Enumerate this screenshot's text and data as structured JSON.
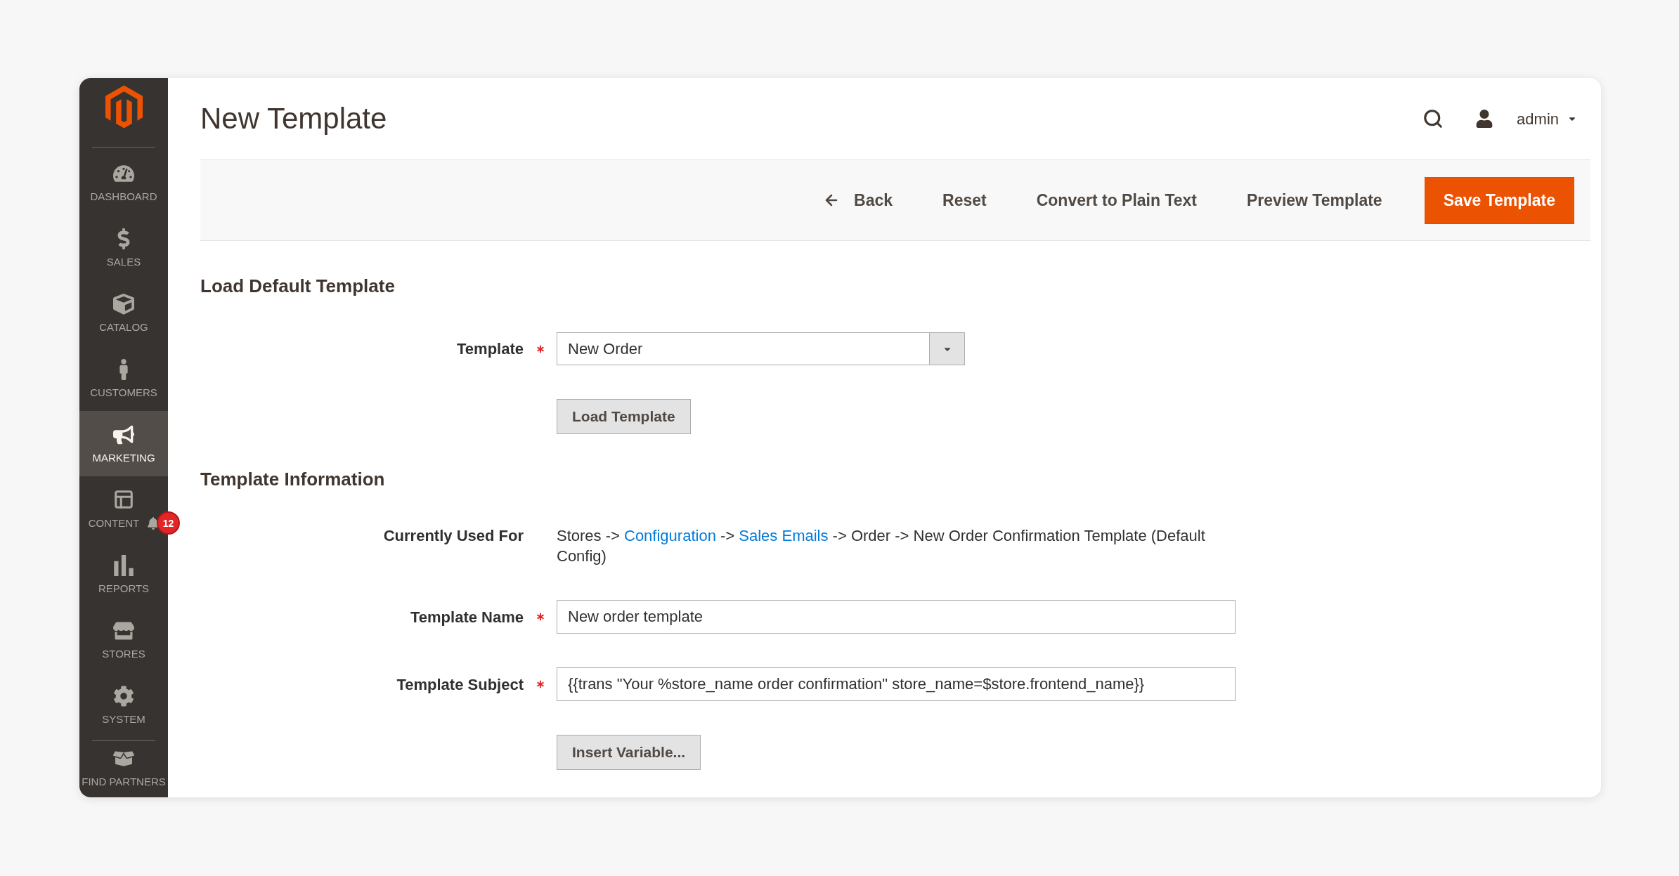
{
  "sidebar": {
    "items": [
      {
        "label": "DASHBOARD",
        "selected": false
      },
      {
        "label": "SALES",
        "selected": false
      },
      {
        "label": "CATALOG",
        "selected": false
      },
      {
        "label": "CUSTOMERS",
        "selected": false
      },
      {
        "label": "MARKETING",
        "selected": true
      },
      {
        "label": "CONTENT",
        "selected": false,
        "notification_count": "12"
      },
      {
        "label": "REPORTS",
        "selected": false
      },
      {
        "label": "STORES",
        "selected": false
      },
      {
        "label": "SYSTEM",
        "selected": false
      }
    ],
    "extra_items": [
      {
        "label": "FIND PARTNERS",
        "selected": false
      }
    ]
  },
  "header": {
    "title": "New Template",
    "user": "admin"
  },
  "toolbar": {
    "buttons": [
      {
        "label": "Back",
        "kind": "back"
      },
      {
        "label": "Reset",
        "kind": "plain"
      },
      {
        "label": "Convert to Plain Text",
        "kind": "plain"
      },
      {
        "label": "Preview Template",
        "kind": "plain"
      },
      {
        "label": "Save Template",
        "kind": "primary"
      }
    ]
  },
  "sections": [
    {
      "title": "Load Default Template",
      "fields": [
        {
          "kind": "select",
          "label": "Template",
          "required": true,
          "value": "New Order"
        },
        {
          "kind": "button",
          "label": "Load Template"
        }
      ]
    },
    {
      "title": "Template Information",
      "fields": [
        {
          "kind": "info",
          "label": "Currently Used For",
          "segments": [
            {
              "kind": "text",
              "text": "Stores ->"
            },
            {
              "kind": "link",
              "text": "Configuration"
            },
            {
              "kind": "text",
              "text": "->"
            },
            {
              "kind": "link",
              "text": "Sales Emails"
            },
            {
              "kind": "text",
              "text": "-> Order -> New Order Confirmation Template (Default Config)"
            }
          ]
        },
        {
          "kind": "text",
          "label": "Template Name",
          "required": true,
          "value": "New order template"
        },
        {
          "kind": "text",
          "label": "Template Subject",
          "required": true,
          "value": "{{trans \"Your %store_name order confirmation\" store_name=$store.frontend_name}}"
        },
        {
          "kind": "button",
          "label": "Insert Variable..."
        }
      ]
    }
  ]
}
